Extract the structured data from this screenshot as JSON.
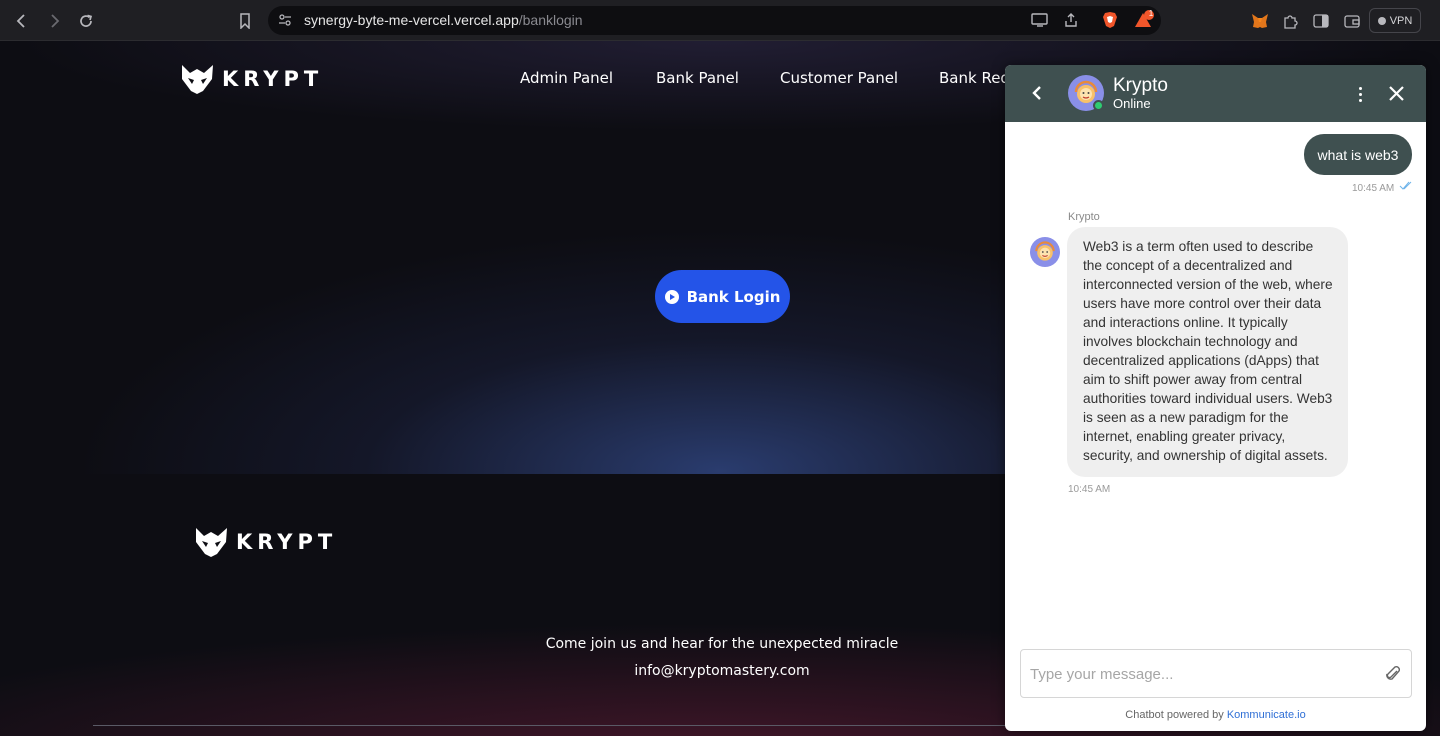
{
  "browser": {
    "url_host": "synergy-byte-me-vercel.vercel.app",
    "url_path": "/banklogin",
    "vpn_label": "VPN",
    "notification_count": "1"
  },
  "site": {
    "logo_text": "KRYPT",
    "nav": [
      {
        "label": "Admin Panel"
      },
      {
        "label": "Bank Panel"
      },
      {
        "label": "Customer Panel"
      },
      {
        "label": "Bank Req"
      }
    ],
    "hero_button_label": "Bank Login",
    "footer_logo_text": "KRYPT",
    "footer_tagline": "Come join us and hear for the unexpected miracle",
    "footer_email": "info@kryptomastery.com",
    "accent_color": "#2454e8"
  },
  "chat": {
    "bot_name": "Krypto",
    "status": "Online",
    "header_color": "#3f5050",
    "user_message": "what is web3",
    "user_time": "10:45 AM",
    "bot_label": "Krypto",
    "bot_message": "Web3 is a term often used to describe the concept of a decentralized and interconnected version of the web, where users have more control over their data and interactions online. It typically involves blockchain technology and decentralized applications (dApps) that aim to shift power away from central authorities toward individual users. Web3 is seen as a new paradigm for the internet, enabling greater privacy, security, and ownership of digital assets.",
    "bot_time": "10:45 AM",
    "input_placeholder": "Type your message...",
    "powered_prefix": "Chatbot powered by",
    "powered_link": "Kommunicate.io"
  }
}
